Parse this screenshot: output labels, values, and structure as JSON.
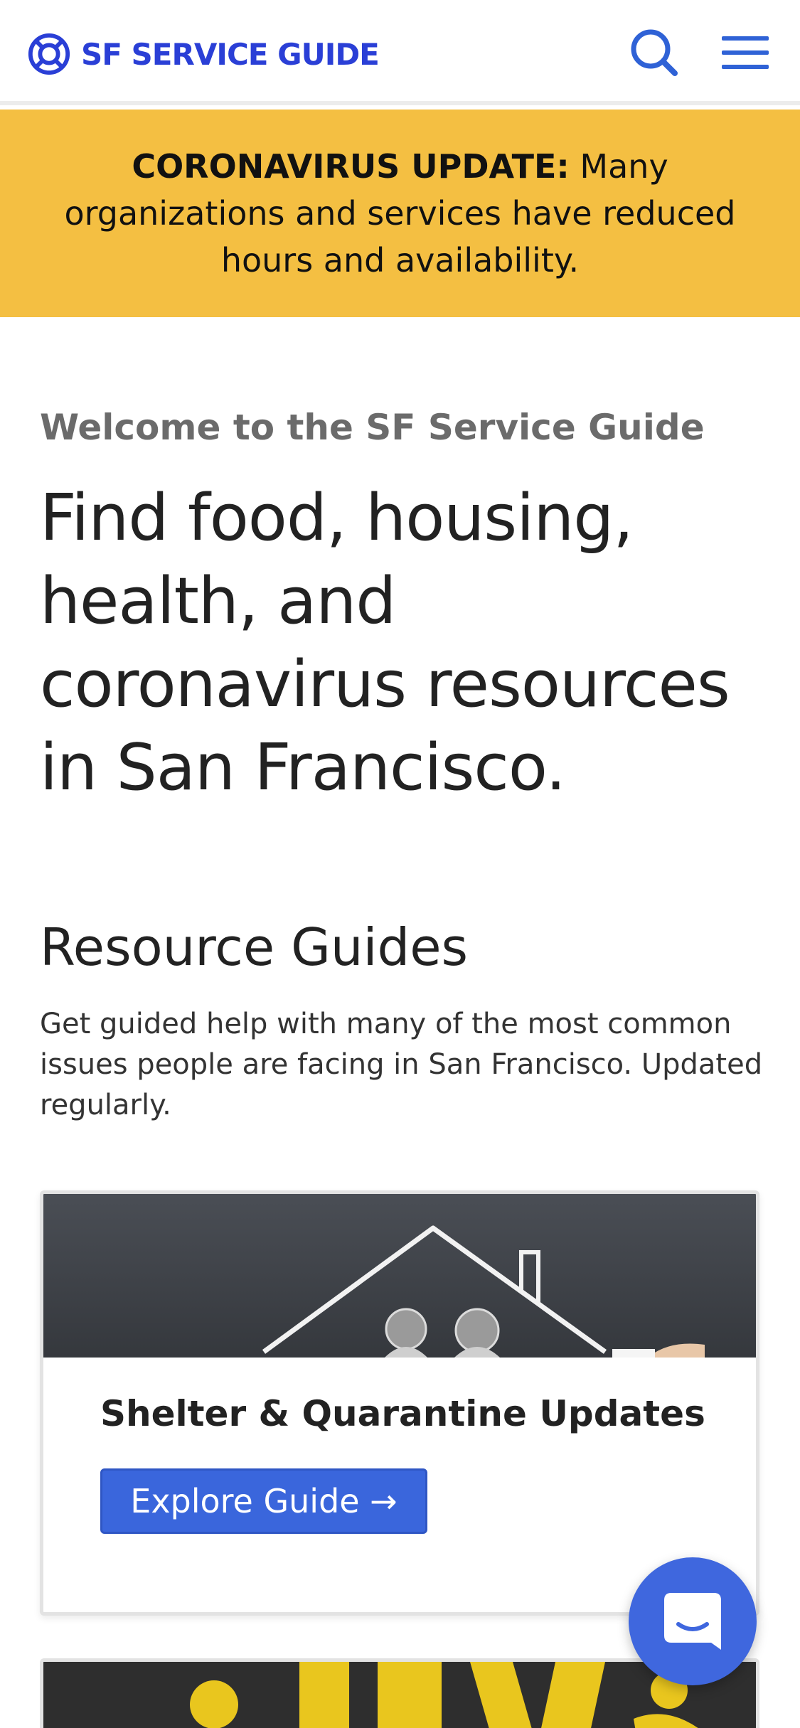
{
  "header": {
    "logo_text": "SF SERVICE GUIDE",
    "logo_icon": "lifebuoy-icon",
    "search_icon": "search-icon",
    "menu_icon": "hamburger-menu-icon",
    "brand_color": "#2a3fd6"
  },
  "banner": {
    "label": "CORONAVIRUS UPDATE:",
    "text": "Many organizations and services have reduced hours and availability.",
    "background_color": "#f4bf42"
  },
  "hero": {
    "welcome": "Welcome to the SF Service Guide",
    "title": "Find food, housing, health, and coronavirus resources in San Francisco."
  },
  "resource_guides": {
    "title": "Resource Guides",
    "description": "Get guided help with many of the most common issues people are facing in San Francisco. Updated regularly.",
    "cards": [
      {
        "title": "Shelter & Quarantine Updates",
        "button_label": "Explore Guide →",
        "button_color": "#3a66dc"
      }
    ]
  },
  "chat": {
    "icon": "chat-bubble-icon",
    "color": "#3f67de"
  }
}
